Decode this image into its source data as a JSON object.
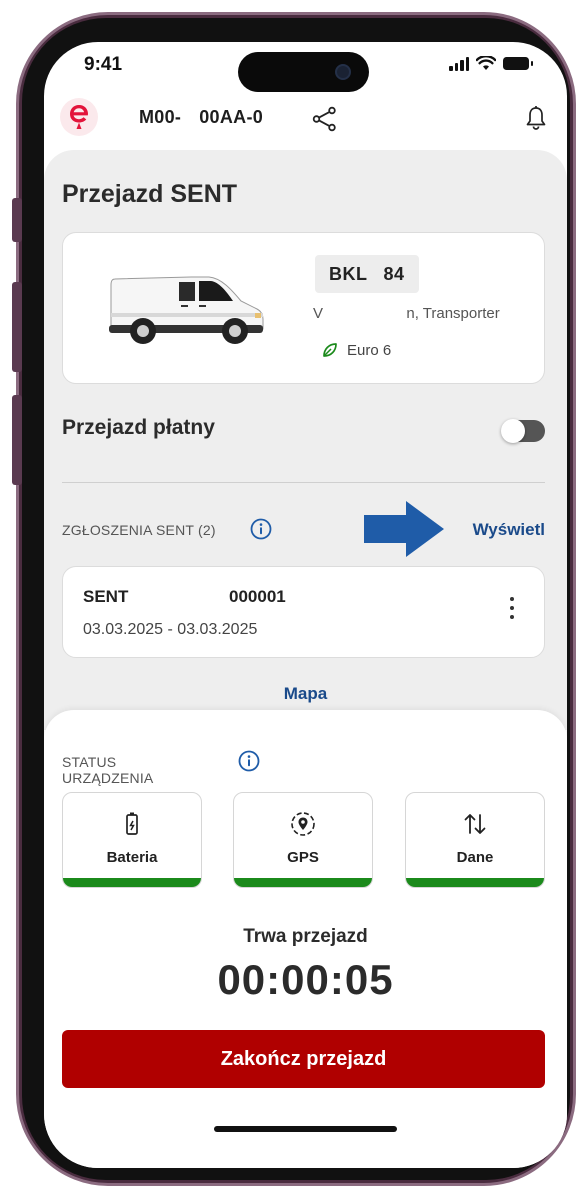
{
  "status_bar": {
    "time": "9:41"
  },
  "header": {
    "plate_parts": [
      "M00-",
      "00AA-0"
    ]
  },
  "page": {
    "title": "Przejazd SENT"
  },
  "vehicle": {
    "plate_parts": [
      "BKL",
      "84"
    ],
    "model": "V                    n, Transporter",
    "emission_class": "Euro 6"
  },
  "paid_ride": {
    "label": "Przejazd płatny",
    "enabled": false
  },
  "sent_section": {
    "label": "ZGŁOSZENIA SENT (2)",
    "view_link": "Wyświetl",
    "arrow_color": "#1f5ca8"
  },
  "sent_item": {
    "name": "SENT",
    "number": "000001",
    "dates": "03.03.2025 - 03.03.2025"
  },
  "map_link": "Mapa",
  "device_status": {
    "label": "STATUS URZĄDZENIA",
    "tiles": [
      {
        "label": "Bateria",
        "icon": "battery-charging-icon",
        "status_color": "#1b8a1b"
      },
      {
        "label": "GPS",
        "icon": "gps-location-icon",
        "status_color": "#1b8a1b"
      },
      {
        "label": "Dane",
        "icon": "data-transfer-icon",
        "status_color": "#1b8a1b"
      }
    ]
  },
  "ride": {
    "status_label": "Trwa przejazd",
    "timer": "00:00:05",
    "end_button": "Zakończ przejazd"
  },
  "colors": {
    "accent_red": "#b00000",
    "link_blue": "#1a4a8a",
    "status_green": "#1b8a1b",
    "brand_red": "#e3143b"
  }
}
